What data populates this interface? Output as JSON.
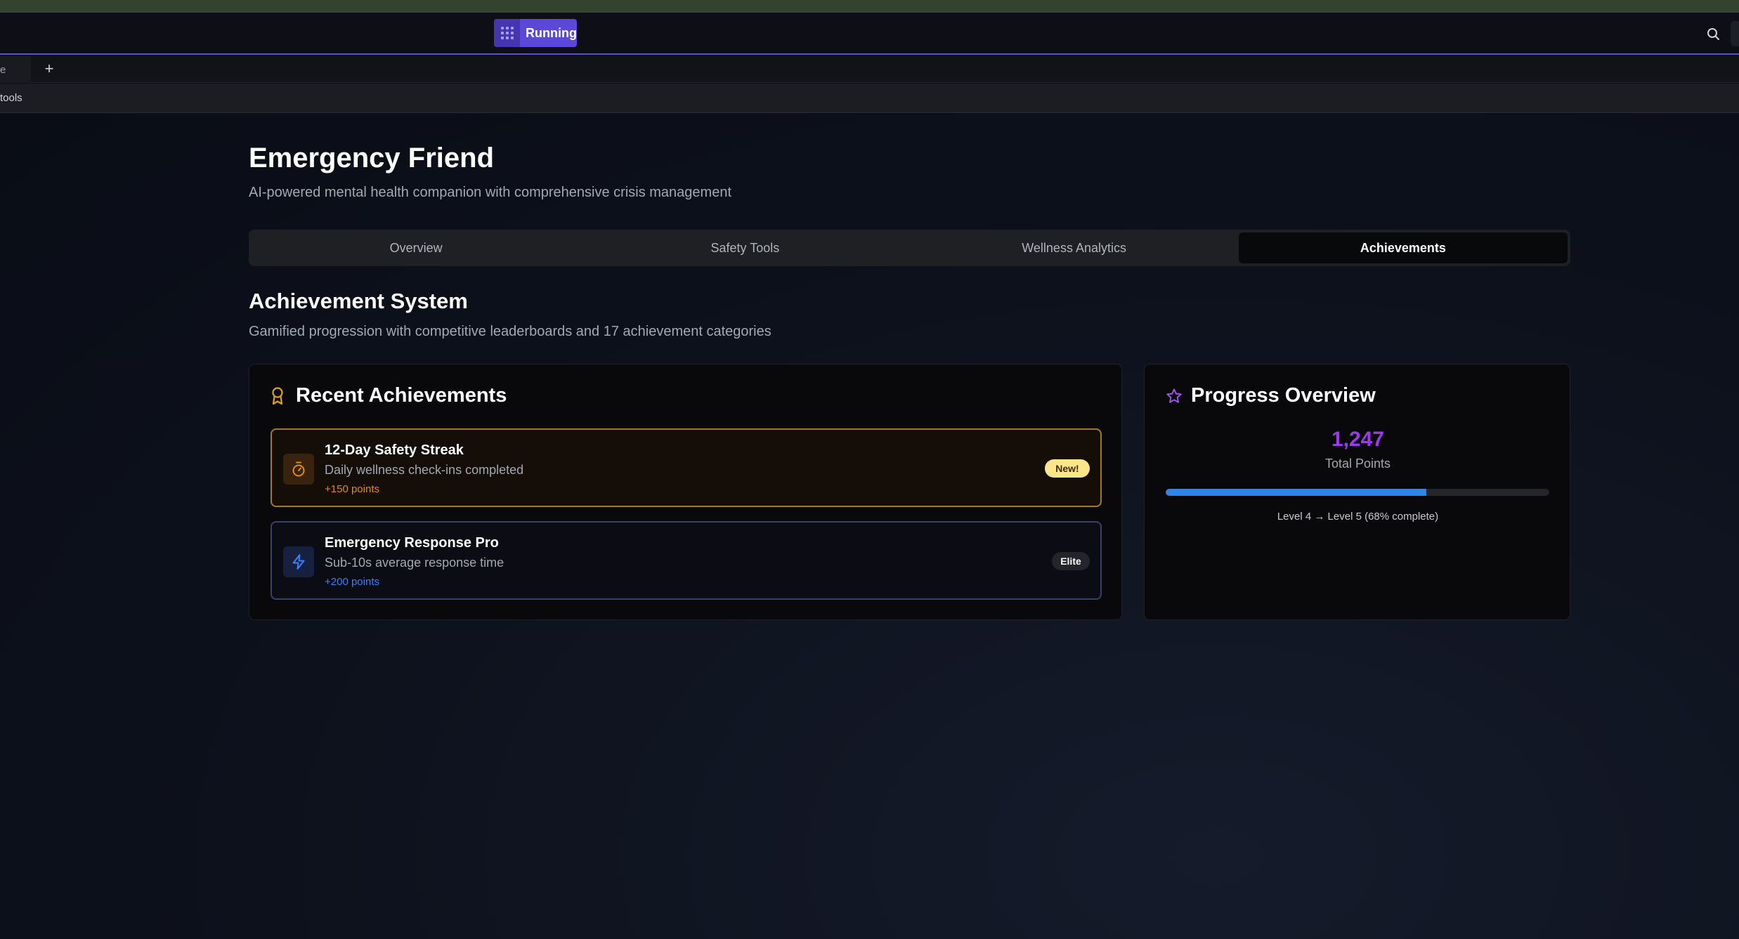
{
  "topbar": {
    "run_badge_label": "Running"
  },
  "tabbar": {
    "tab_stub_label": "e",
    "new_tab_label": "+"
  },
  "toolsbar": {
    "label": "tools"
  },
  "app": {
    "title": "Emergency Friend",
    "subtitle": "AI-powered mental health companion with comprehensive crisis management"
  },
  "tabs": [
    {
      "label": "Overview",
      "active": false
    },
    {
      "label": "Safety Tools",
      "active": false
    },
    {
      "label": "Wellness Analytics",
      "active": false
    },
    {
      "label": "Achievements",
      "active": true
    }
  ],
  "section": {
    "title": "Achievement System",
    "subtitle": "Gamified progression with competitive leaderboards and 17 achievement categories"
  },
  "recent": {
    "title": "Recent Achievements",
    "icon": "award-icon",
    "items": [
      {
        "name": "12-Day Safety Streak",
        "description": "Daily wellness check-ins completed",
        "points": "+150 points",
        "badge": "New!",
        "icon": "timer-icon",
        "accent": "#e08a1e"
      },
      {
        "name": "Emergency Response Pro",
        "description": "Sub-10s average response time",
        "points": "+200 points",
        "badge": "Elite",
        "icon": "lightning-icon",
        "accent": "#3b82f6"
      }
    ]
  },
  "progress": {
    "title": "Progress Overview",
    "icon": "star-icon",
    "total_points": "1,247",
    "total_points_label": "Total Points",
    "percent_complete": 68,
    "level_text": "Level 4 → Level 5 (68% complete)"
  },
  "colors": {
    "accent_purple": "#9b3ae8",
    "progress_blue": "#2f86e8",
    "streak_gold": "#a47b1c",
    "run_badge": "#5b47d8"
  }
}
